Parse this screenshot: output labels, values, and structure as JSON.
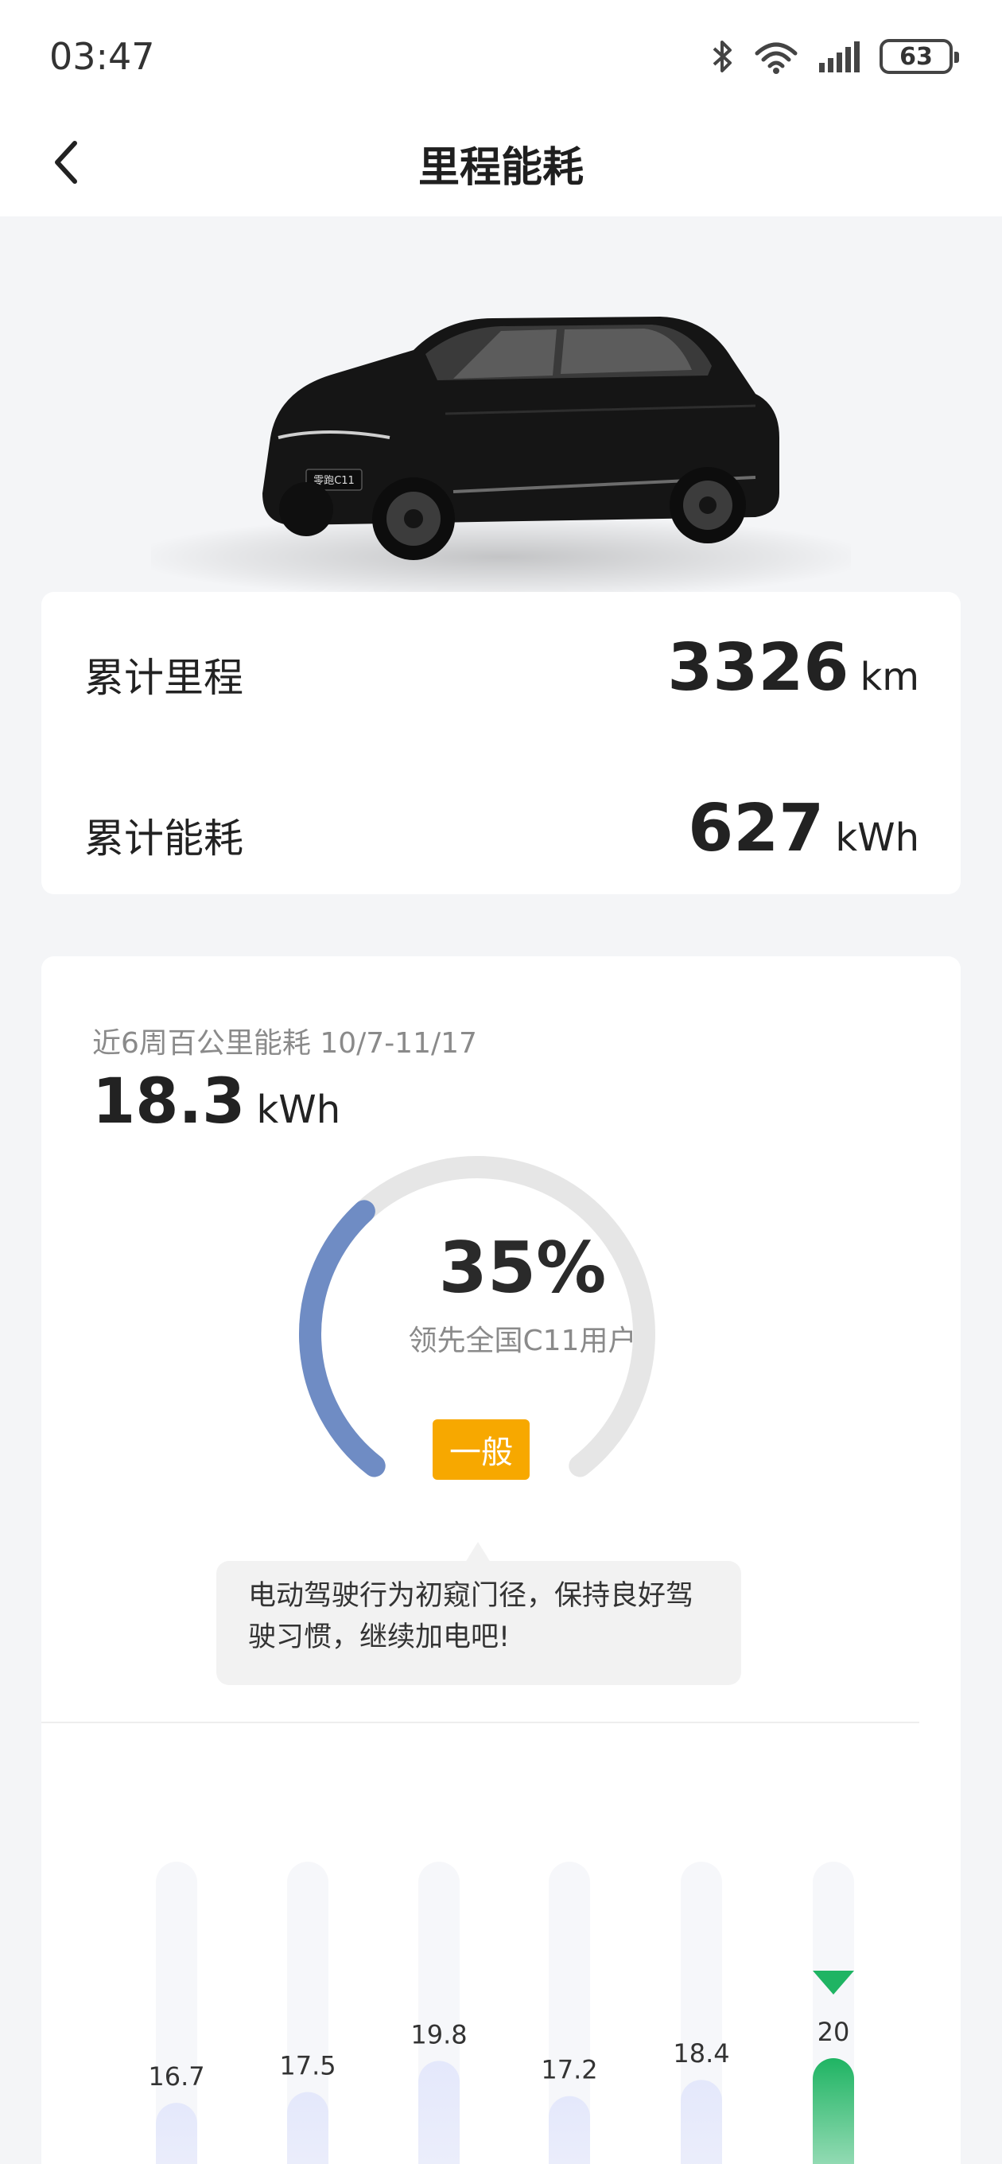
{
  "status_bar": {
    "time": "03:47",
    "battery": "63",
    "icons": [
      "bluetooth-icon",
      "wifi-icon",
      "signal-icon",
      "battery-icon"
    ]
  },
  "nav": {
    "title": "里程能耗",
    "back_icon": "chevron-left-icon"
  },
  "car": {
    "plate_text": "零跑C11"
  },
  "stats": {
    "mileage_label": "累计里程",
    "mileage_value": "3326",
    "mileage_unit": "km",
    "energy_label": "累计能耗",
    "energy_value": "627",
    "energy_unit": "kWh"
  },
  "efficiency": {
    "period_label": "近6周百公里能耗 10/7-11/17",
    "avg_value": "18.3",
    "avg_unit": "kWh",
    "percent": "35%",
    "percent_value": 0.35,
    "percent_caption": "领先全国C11用户",
    "rating": "一般",
    "tip": "电动驾驶行为初窥门径，保持良好驾驶习惯，继续加电吧!",
    "colors": {
      "gauge_fill": "#6f8cc4",
      "gauge_track": "#e6e6e6",
      "badge": "#f7a800",
      "bar_normal": "#e6eafb",
      "bar_track": "#f6f7fa",
      "bar_highlight": "#1fb463"
    }
  },
  "chart_data": {
    "type": "bar",
    "values": [
      16.7,
      17.5,
      19.8,
      17.2,
      18.4,
      20
    ],
    "labels": [
      "16.7",
      "17.5",
      "19.8",
      "17.2",
      "18.4",
      "20"
    ],
    "highlight_index": 5
  }
}
